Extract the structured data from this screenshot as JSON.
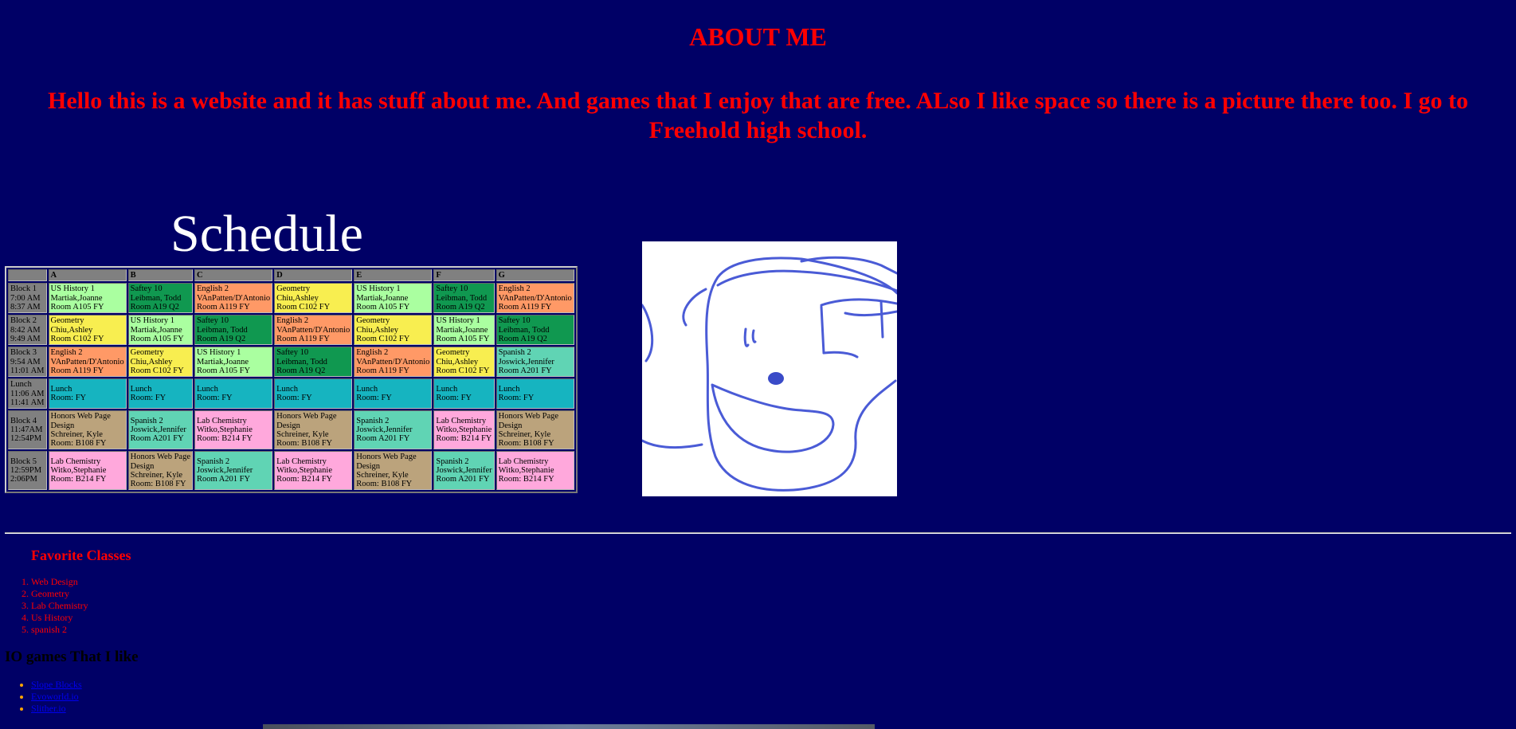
{
  "about": {
    "title": "ABOUT ME",
    "intro": "Hello this is a website and it has stuff about me. And games that I enjoy that are free. ALso I like space so there is a picture there too. I go to Freehold high school."
  },
  "schedule": {
    "title": "Schedule",
    "columns": [
      "",
      "A",
      "B",
      "C",
      "D",
      "E",
      "F",
      "G"
    ],
    "rows": [
      {
        "block": [
          "Block 1",
          "7:00 AM",
          "8:37 AM"
        ],
        "cells": [
          {
            "lines": [
              "US History 1",
              "Martiak,Joanne",
              "Room A105 FY"
            ],
            "color": "#aaffa0"
          },
          {
            "lines": [
              "Saftey 10",
              "Leibman, Todd",
              "Room A19 Q2"
            ],
            "color": "#109850"
          },
          {
            "lines": [
              "English 2",
              "VAnPatten/D'Antonio",
              "Room A119 FY"
            ],
            "color": "#ff9966"
          },
          {
            "lines": [
              "Geometry",
              "Chiu,Ashley",
              "Room C102 FY"
            ],
            "color": "#f8ee50"
          },
          {
            "lines": [
              "US History 1",
              "Martiak,Joanne",
              "Room A105 FY"
            ],
            "color": "#aaffa0"
          },
          {
            "lines": [
              "Saftey 10",
              "Leibman, Todd",
              "Room A19 Q2"
            ],
            "color": "#109850"
          },
          {
            "lines": [
              "English 2",
              "VAnPatten/D'Antonio",
              "Room A119 FY"
            ],
            "color": "#ff9966"
          }
        ]
      },
      {
        "block": [
          "Block 2",
          "8:42 AM",
          "9:49 AM"
        ],
        "cells": [
          {
            "lines": [
              "Geometry",
              "Chiu,Ashley",
              "Room C102 FY"
            ],
            "color": "#f8ee50"
          },
          {
            "lines": [
              "US History 1",
              "Martiak,Joanne",
              "Room A105 FY"
            ],
            "color": "#aaffa0"
          },
          {
            "lines": [
              "Saftey 10",
              "Leibman, Todd",
              "Room A19 Q2"
            ],
            "color": "#109850"
          },
          {
            "lines": [
              "English 2",
              "VAnPatten/D'Antonio",
              "Room A119 FY"
            ],
            "color": "#ff9966"
          },
          {
            "lines": [
              "Geometry",
              "Chiu,Ashley",
              "Room C102 FY"
            ],
            "color": "#f8ee50"
          },
          {
            "lines": [
              "US History 1",
              "Martiak,Joanne",
              "Room A105 FY"
            ],
            "color": "#aaffa0"
          },
          {
            "lines": [
              "Saftey 10",
              "Leibman, Todd",
              "Room A19 Q2"
            ],
            "color": "#109850"
          }
        ]
      },
      {
        "block": [
          "Block 3",
          "9:54 AM",
          "11:01 AM"
        ],
        "cells": [
          {
            "lines": [
              "English 2",
              "VAnPatten/D'Antonio",
              "Room A119 FY"
            ],
            "color": "#ff9966"
          },
          {
            "lines": [
              "Geometry",
              "Chiu,Ashley",
              "Room C102 FY"
            ],
            "color": "#f8ee50"
          },
          {
            "lines": [
              "US History 1",
              "Martiak,Joanne",
              "Room A105 FY"
            ],
            "color": "#aaffa0"
          },
          {
            "lines": [
              "Saftey 10",
              "Leibman, Todd",
              "Room A19 Q2"
            ],
            "color": "#109850"
          },
          {
            "lines": [
              "English 2",
              "VAnPatten/D'Antonio",
              "Room A119 FY"
            ],
            "color": "#ff9966"
          },
          {
            "lines": [
              "Geometry",
              "Chiu,Ashley",
              "Room C102 FY"
            ],
            "color": "#f8ee50"
          },
          {
            "lines": [
              "Spanish 2",
              "Joswick,Jennifer",
              "Room A201 FY"
            ],
            "color": "#60d4b4"
          }
        ]
      },
      {
        "block": [
          "Lunch",
          "11:06 AM",
          "11:41 AM"
        ],
        "cells": [
          {
            "lines": [
              "Lunch",
              "Room: FY"
            ],
            "color": "#16b4c0"
          },
          {
            "lines": [
              "Lunch",
              "Room: FY"
            ],
            "color": "#16b4c0"
          },
          {
            "lines": [
              "Lunch",
              "Room: FY"
            ],
            "color": "#16b4c0"
          },
          {
            "lines": [
              "Lunch",
              "Room: FY"
            ],
            "color": "#16b4c0"
          },
          {
            "lines": [
              "Lunch",
              "Room: FY"
            ],
            "color": "#16b4c0"
          },
          {
            "lines": [
              "Lunch",
              "Room: FY"
            ],
            "color": "#16b4c0"
          },
          {
            "lines": [
              "Lunch",
              "Room: FY"
            ],
            "color": "#16b4c0"
          }
        ]
      },
      {
        "block": [
          "Block 4",
          "11:47AM",
          "12:54PM"
        ],
        "cells": [
          {
            "lines": [
              "Honors Web Page",
              "Design",
              "Schreiner, Kyle",
              "Room: B108 FY"
            ],
            "color": "#bba37c"
          },
          {
            "lines": [
              "Spanish 2",
              "Joswick,Jennifer",
              "Room A201 FY"
            ],
            "color": "#60d4b4"
          },
          {
            "lines": [
              "Lab Chemistry",
              "Witko,Stephanie",
              "Room: B214 FY"
            ],
            "color": "#ffa8dc"
          },
          {
            "lines": [
              "Honors Web Page",
              "Design",
              "Schreiner, Kyle",
              "Room: B108 FY"
            ],
            "color": "#bba37c"
          },
          {
            "lines": [
              "Spanish 2",
              "Joswick,Jennifer",
              "Room A201 FY"
            ],
            "color": "#60d4b4"
          },
          {
            "lines": [
              "Lab Chemistry",
              "Witko,Stephanie",
              "Room: B214 FY"
            ],
            "color": "#ffa8dc"
          },
          {
            "lines": [
              "Honors Web Page",
              "Design",
              "Schreiner, Kyle",
              "Room: B108 FY"
            ],
            "color": "#bba37c"
          }
        ]
      },
      {
        "block": [
          "Block 5",
          "12:59PM",
          "2:06PM"
        ],
        "cells": [
          {
            "lines": [
              "Lab Chemistry",
              "Witko,Stephanie",
              "Room: B214 FY"
            ],
            "color": "#ffa8dc"
          },
          {
            "lines": [
              "Honors Web Page",
              "Design",
              "Schreiner, Kyle",
              "Room: B108 FY"
            ],
            "color": "#bba37c"
          },
          {
            "lines": [
              "Spanish 2",
              "Joswick,Jennifer",
              "Room A201 FY"
            ],
            "color": "#60d4b4"
          },
          {
            "lines": [
              "Lab Chemistry",
              "Witko,Stephanie",
              "Room: B214 FY"
            ],
            "color": "#ffa8dc"
          },
          {
            "lines": [
              "Honors Web Page",
              "Design",
              "Schreiner, Kyle",
              "Room: B108 FY"
            ],
            "color": "#bba37c"
          },
          {
            "lines": [
              "Spanish 2",
              "Joswick,Jennifer",
              "Room A201 FY"
            ],
            "color": "#60d4b4"
          },
          {
            "lines": [
              "Lab Chemistry",
              "Witko,Stephanie",
              "Room: B214 FY"
            ],
            "color": "#ffa8dc"
          }
        ]
      }
    ]
  },
  "drawing": {
    "icon": "doodle-face-drawing"
  },
  "favorite_classes": {
    "title": "Favorite Classes",
    "items": [
      "Web Design",
      "Geometry",
      "Lab Chemistry",
      "Us History",
      "spanish 2"
    ]
  },
  "io_games": {
    "title": "IO games That I like",
    "items": [
      "Slope Blocks",
      "Evoworld.io",
      "Slither.io"
    ]
  },
  "colors": {
    "background": "#000066",
    "heading_red": "#ff0000",
    "schedule_title": "#ffffff",
    "link": "#0000ee",
    "bullet": "#ffa500"
  }
}
